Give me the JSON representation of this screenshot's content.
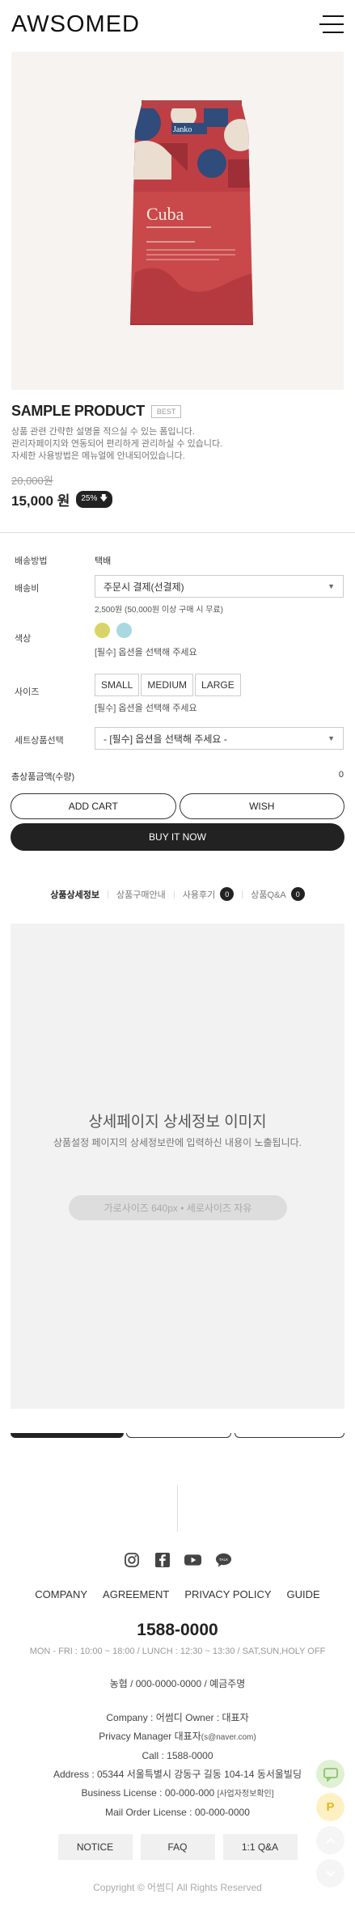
{
  "header": {
    "logo": "AWSOMED",
    "menu_icon": "hamburger-icon"
  },
  "product": {
    "title": "SAMPLE PRODUCT",
    "badge": "BEST",
    "description": "상품 관련 간략한 설명을 적으실 수 있는 폼입니다.\n관리자페이지와 연동되어 편리하게 관리하실 수 있습니다.\n자세한 사용방법은 메뉴얼에 안내되어있습니다.",
    "original_price": "20,000원",
    "price": "15,000 원",
    "discount": "25%",
    "package": {
      "brand": "Janko",
      "name": "Cuba"
    }
  },
  "options": {
    "shipping_method_label": "배송방법",
    "shipping_method_value": "택배",
    "shipping_fee_label": "배송비",
    "shipping_fee_select": "주문시 결제(선결제)",
    "shipping_fee_note": "2,500원 (50,000원 이상 구매 시 무료)",
    "color_label": "색상",
    "colors": [
      "#d9d36a",
      "#a9d8e0"
    ],
    "color_hint": "[필수] 옵션을 선택해 주세요",
    "size_label": "사이즈",
    "sizes": [
      "SMALL",
      "MEDIUM",
      "LARGE"
    ],
    "size_hint": "[필수] 옵션을 선택해 주세요",
    "set_label": "세트상품선택",
    "set_select": "- [필수] 옵션을 선택해 주세요 -"
  },
  "total": {
    "label": "총상품금액(수량)",
    "value": "0"
  },
  "actions": {
    "add_cart": "ADD CART",
    "wish": "WISH",
    "buy_now": "BUY IT NOW"
  },
  "tabs": [
    {
      "label": "상품상세정보"
    },
    {
      "label": "상품구매안내"
    },
    {
      "label": "사용후기",
      "count": "0"
    },
    {
      "label": "상품Q&A",
      "count": "0"
    }
  ],
  "detail": {
    "title": "상세페이지 상세정보 이미지",
    "subtitle": "상품설정 페이지의 상세정보란에 입력하신 내용이 노출됩니다.",
    "size_note": "가로사이즈 640px • 세로사이즈 자유"
  },
  "footer": {
    "social_icons": [
      "instagram-icon",
      "facebook-icon",
      "youtube-icon",
      "talk-icon"
    ],
    "talk_icon_text": "TALK",
    "nav": [
      "COMPANY",
      "AGREEMENT",
      "PRIVACY POLICY",
      "GUIDE"
    ],
    "phone": "1588-0000",
    "hours": "MON - FRI : 10:00 ~ 18:00 / LUNCH : 12:30 ~ 13:30 / SAT,SUN,HOLY OFF",
    "bank": "농협 / 000-0000-0000 / 예금주명",
    "company_line": "Company : 어썸디  Owner : 대표자",
    "privacy_manager": "Privacy Manager 대표자",
    "privacy_email": "(s@naver.com)",
    "call": "Call : 1588-0000",
    "address": "Address : 05344 서울특별시 강동구 길동 104-14 동서울빌딩",
    "business_license": "Business License : 00-000-000",
    "business_check": "[사업자정보확인]",
    "mail_order": "Mail Order License : 00-000-0000",
    "buttons": [
      "NOTICE",
      "FAQ",
      "1:1 Q&A"
    ],
    "copyright": "Copyright © 어썸디 All Rights Reserved"
  },
  "floating": {
    "talk_icon": "talk-chat-icon",
    "point_icon": "P"
  },
  "colors": {
    "accent": "#222222",
    "detail_bg": "#f2f2f2",
    "hero_bg": "#f7f3f0"
  }
}
